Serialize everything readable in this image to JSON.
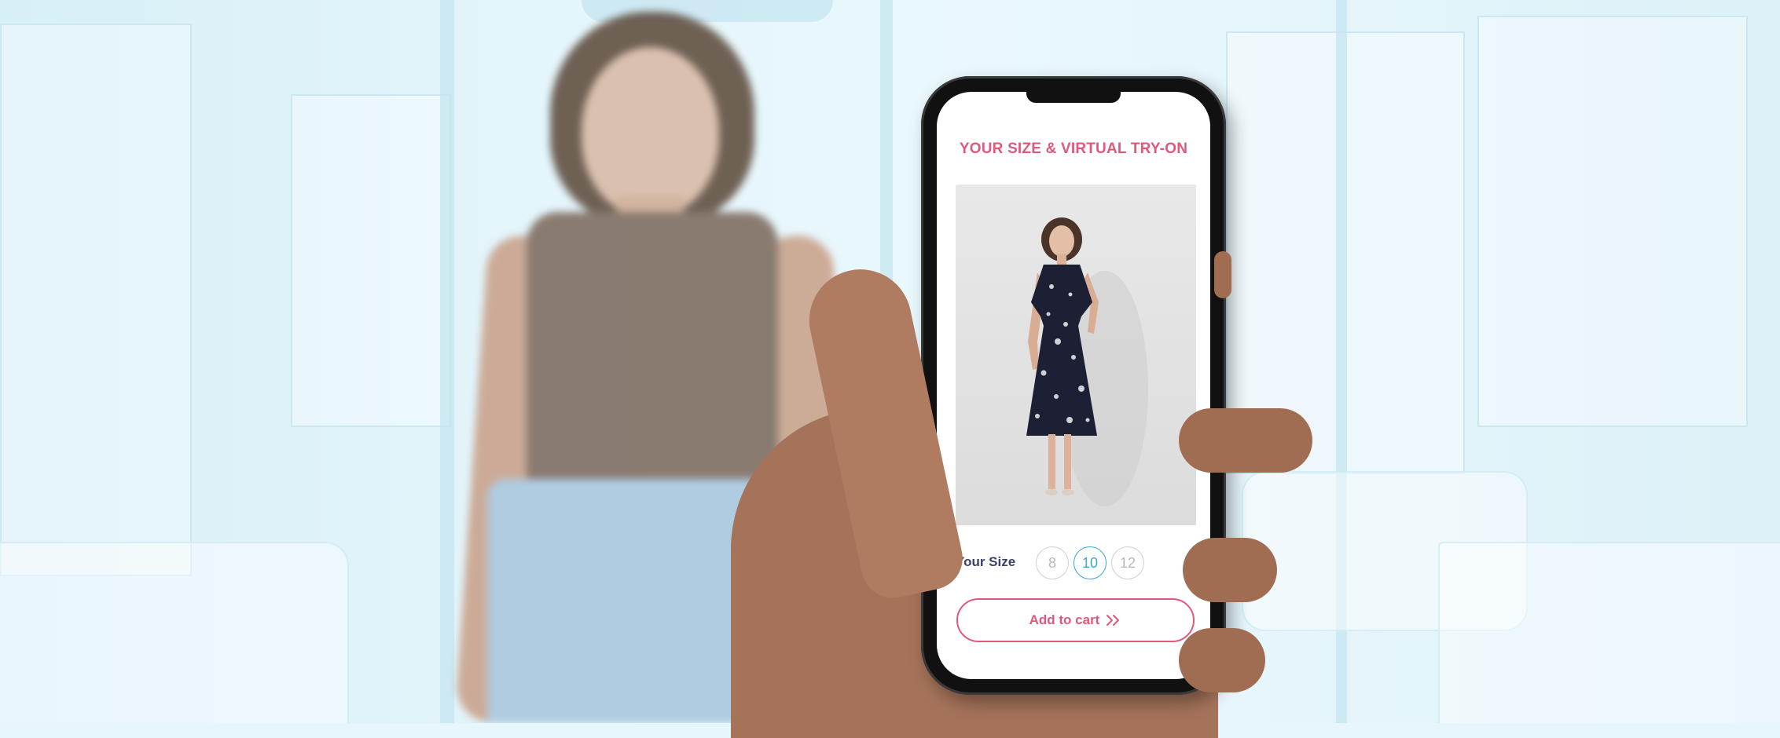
{
  "app": {
    "title": "YOUR SIZE & VIRTUAL TRY-ON"
  },
  "size_selector": {
    "label": "Your Size",
    "options": [
      "8",
      "10",
      "12"
    ],
    "selected": "10"
  },
  "cart_button": {
    "label": "Add to cart",
    "icon": "double-chevron-right-icon"
  },
  "colors": {
    "accent": "#e0587a",
    "selected": "#3aa6d8",
    "label": "#3b3f6b"
  }
}
